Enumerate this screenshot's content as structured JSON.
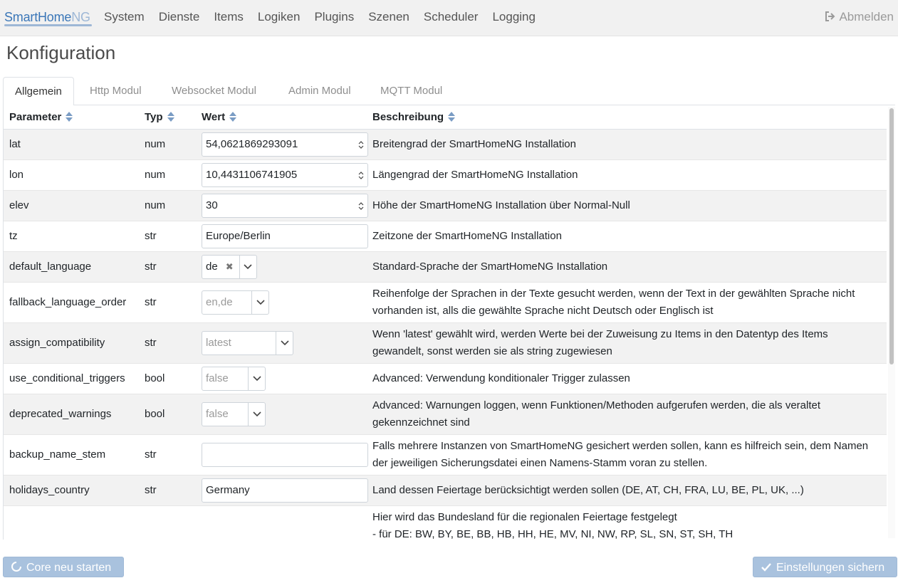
{
  "brand": {
    "main": "SmartHome",
    "suffix": "NG"
  },
  "nav": [
    "System",
    "Dienste",
    "Items",
    "Logiken",
    "Plugins",
    "Szenen",
    "Scheduler",
    "Logging"
  ],
  "logout_label": "Abmelden",
  "page_title": "Konfiguration",
  "tabs": [
    "Allgemein",
    "Http Modul",
    "Websocket Modul",
    "Admin Modul",
    "MQTT Modul"
  ],
  "table": {
    "headers": [
      "Parameter",
      "Typ",
      "Wert",
      "Beschreibung"
    ],
    "rows": [
      {
        "param": "lat",
        "type": "num",
        "value": "54,0621869293091",
        "desc": "Breitengrad der SmartHomeNG Installation"
      },
      {
        "param": "lon",
        "type": "num",
        "value": "10,4431106741905",
        "desc": "Längengrad der SmartHomeNG Installation"
      },
      {
        "param": "elev",
        "type": "num",
        "value": "30",
        "desc": "Höhe der SmartHomeNG Installation über Normal-Null"
      },
      {
        "param": "tz",
        "type": "str",
        "value": "Europe/Berlin",
        "desc": "Zeitzone der SmartHomeNG Installation"
      },
      {
        "param": "default_language",
        "type": "str",
        "value": "de",
        "desc": "Standard-Sprache der SmartHomeNG Installation"
      },
      {
        "param": "fallback_language_order",
        "type": "str",
        "value": "en,de",
        "desc": "Reihenfolge der Sprachen in der Texte gesucht werden, wenn der Text in der gewählten Sprache nicht vorhanden ist, alls die gewählte Sprache nicht Deutsch oder Englisch ist"
      },
      {
        "param": "assign_compatibility",
        "type": "str",
        "value": "latest",
        "desc": "Wenn 'latest' gewählt wird, werden Werte bei der Zuweisung zu Items in den Datentyp des Items gewandelt, sonst werden sie als string zugewiesen"
      },
      {
        "param": "use_conditional_triggers",
        "type": "bool",
        "value": "false",
        "desc": "Advanced: Verwendung konditionaler Trigger zulassen"
      },
      {
        "param": "deprecated_warnings",
        "type": "bool",
        "value": "false",
        "desc": "Advanced: Warnungen loggen, wenn Funktionen/Methoden aufgerufen werden, die als veraltet gekennzeichnet sind"
      },
      {
        "param": "backup_name_stem",
        "type": "str",
        "value": "",
        "desc": "Falls mehrere Instanzen von SmartHomeNG gesichert werden sollen, kann es hilfreich sein, dem Namen der jeweiligen Sicherungsdatei einen Namens-Stamm voran zu stellen."
      },
      {
        "param": "holidays_country",
        "type": "str",
        "value": "Germany",
        "desc": "Land dessen Feiertage berücksichtigt werden sollen (DE, AT, CH, FRA, LU, BE, PL, UK, ...)"
      },
      {
        "param": "",
        "type": "",
        "value": "",
        "desc_line1": "Hier wird das Bundesland für die regionalen Feiertage festgelegt",
        "desc_line2": "- für DE: BW, BY, BE, BB, HB, HH, HE, MV, NI, NW, RP, SL, SN, ST, SH, TH"
      }
    ]
  },
  "buttons": {
    "restart": "Core neu starten",
    "save": "Einstellungen sichern"
  },
  "colors": {
    "brand": "#3b77b8",
    "button": "#a9c2de",
    "row_alt": "#f2f2f2"
  }
}
